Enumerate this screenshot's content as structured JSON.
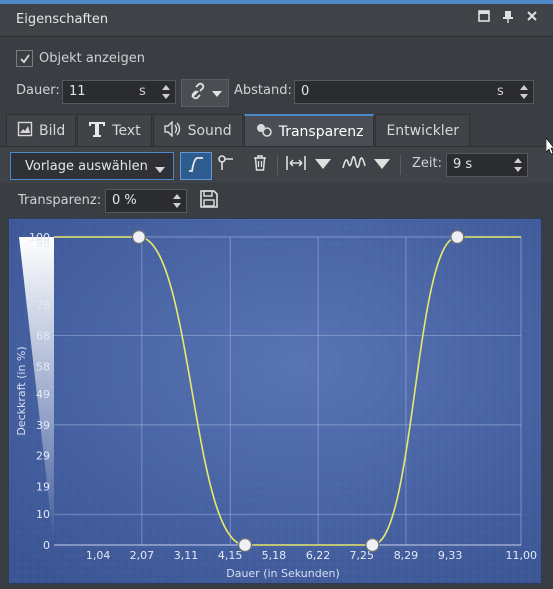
{
  "window": {
    "title": "Eigenschaften",
    "accent": "#4d88c8"
  },
  "title_icons": [
    "maximize-icon",
    "pin-icon",
    "close-icon"
  ],
  "show_object": {
    "label": "Objekt anzeigen",
    "checked": true
  },
  "duration": {
    "label": "Dauer:",
    "value": "11",
    "unit": "s"
  },
  "distance": {
    "label": "Abstand:",
    "value": "0",
    "unit": "s"
  },
  "tabs": [
    {
      "label": "Bild",
      "icon": "image-icon"
    },
    {
      "label": "Text",
      "icon": "text-icon"
    },
    {
      "label": "Sound",
      "icon": "speaker-icon"
    },
    {
      "label": "Transparenz",
      "icon": "transparency-icon",
      "active": true
    },
    {
      "label": "Entwickler",
      "icon": ""
    }
  ],
  "toolbar": {
    "template_select": "Vorlage auswählen",
    "time_label": "Zeit:",
    "time_value": "9 s"
  },
  "transparency": {
    "label": "Transparenz:",
    "value": "0 %"
  },
  "chart_data": {
    "type": "line",
    "xlabel": "Dauer (in Sekunden)",
    "ylabel": "Deckkraft (in %)",
    "xlim": [
      0,
      11
    ],
    "ylim": [
      0,
      100
    ],
    "x_ticks": [
      "1,04",
      "2,07",
      "3,11",
      "4,15",
      "5,18",
      "6,22",
      "7,25",
      "8,29",
      "9,33",
      "11,00"
    ],
    "x_tick_values": [
      1.04,
      2.07,
      3.11,
      4.15,
      5.18,
      6.22,
      7.25,
      8.29,
      9.33,
      11.0
    ],
    "y_ticks": [
      "100",
      "98",
      "88",
      "78",
      "68",
      "58",
      "49",
      "39",
      "29",
      "19",
      "10",
      "0"
    ],
    "y_tick_values": [
      100,
      98,
      88,
      78,
      68,
      58,
      49,
      39,
      29,
      19,
      10,
      0
    ],
    "keyframes": [
      {
        "x": 2.0,
        "y": 100
      },
      {
        "x": 4.5,
        "y": 0
      },
      {
        "x": 7.5,
        "y": 0
      },
      {
        "x": 9.5,
        "y": 100
      }
    ],
    "series": [
      {
        "x": [
          0,
          2.0,
          4.5,
          7.5,
          9.5,
          11.0
        ],
        "y": [
          100,
          100,
          0,
          0,
          100,
          100
        ]
      }
    ],
    "colors": {
      "background": "#4a66a8",
      "line": "#e4e46a",
      "grid": "#7c93c8"
    }
  }
}
